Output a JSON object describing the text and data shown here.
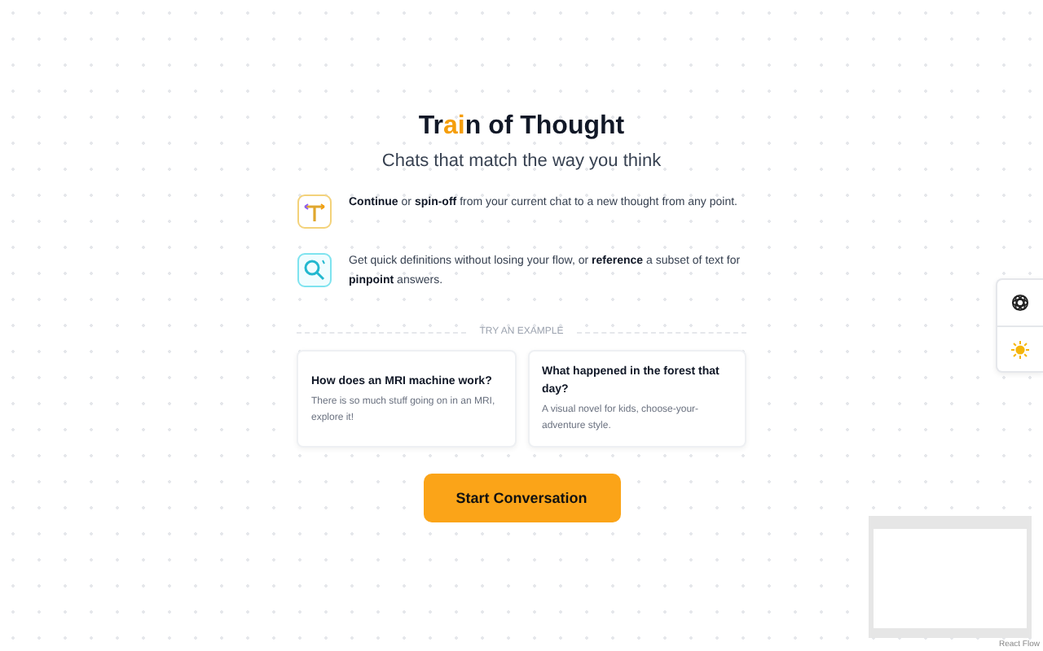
{
  "title_parts": [
    {
      "text": "Tr",
      "highlight": false
    },
    {
      "text": "ai",
      "highlight": true
    },
    {
      "text": "n of Thought",
      "highlight": false
    }
  ],
  "subtitle": "Chats that match the way you think",
  "features": [
    {
      "kind": "branch",
      "text": "**Continue** or **spin-off** from your current chat to a new thought from any point."
    },
    {
      "kind": "search",
      "text": "Get quick definitions without losing your flow, or **reference** a subset of text for **pinpoint** answers."
    }
  ],
  "divider_label": "TRY AN EXAMPLE",
  "examples": [
    {
      "title": "How does an MRI machine work?",
      "description": "There is so much stuff going on in an MRI, explore it!"
    },
    {
      "title": "What happened in the forest that day?",
      "description": "A visual novel for kids, choose-your-adventure style."
    }
  ],
  "start_button": "Start Conversation",
  "side_controls": [
    {
      "kind": "model"
    },
    {
      "kind": "theme"
    }
  ],
  "attribution": "React Flow"
}
